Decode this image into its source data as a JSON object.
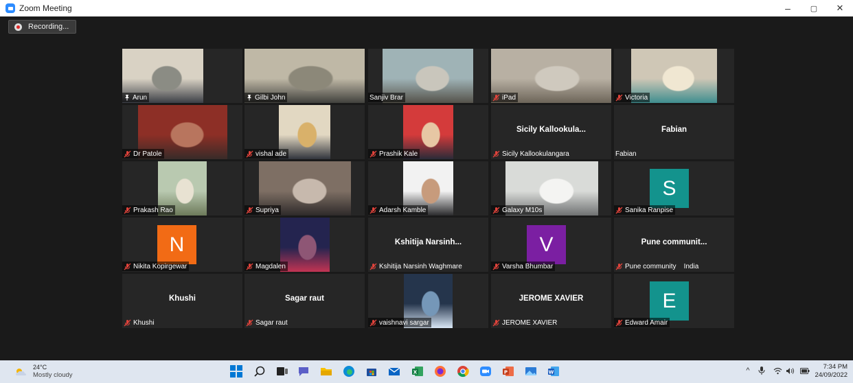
{
  "window": {
    "title": "Zoom Meeting",
    "controls": [
      "–",
      "▢",
      "✕"
    ]
  },
  "recording": {
    "label": "Recording..."
  },
  "accent": "#9cd33c",
  "tiles": [
    {
      "name": "Arun",
      "type": "video",
      "pinned": true
    },
    {
      "name": "Gilbi John",
      "type": "video",
      "pinned": true,
      "active": true
    },
    {
      "name": "Sanjiv Brar",
      "type": "video",
      "no_mic": true
    },
    {
      "name": "iPad",
      "type": "video"
    },
    {
      "name": "Victoria",
      "type": "video"
    },
    {
      "name": "Dr Patole",
      "type": "video"
    },
    {
      "name": "vishal ade",
      "type": "video"
    },
    {
      "name": "Prashik Kale",
      "type": "video"
    },
    {
      "name": "Sicily Kallookulangara",
      "type": "name",
      "display": "Sicily  Kallookula..."
    },
    {
      "name": "Fabian",
      "type": "name",
      "display": "Fabian",
      "no_mic": true
    },
    {
      "name": "Prakash Rao",
      "type": "video"
    },
    {
      "name": "Supriya",
      "type": "video"
    },
    {
      "name": "Adarsh Kamble",
      "type": "video"
    },
    {
      "name": "Galaxy M10s",
      "type": "video"
    },
    {
      "name": "Sanika Ranpise",
      "type": "avatar",
      "letter": "S",
      "color": "#13938d"
    },
    {
      "name": "Nikita Kopirgewar",
      "type": "avatar",
      "letter": "N",
      "color": "#f26b15"
    },
    {
      "name": "Magdalen",
      "type": "video"
    },
    {
      "name": "Kshitija Narsinh Waghmare",
      "type": "name",
      "display": "Kshitija  Narsinh..."
    },
    {
      "name": "Varsha Bhumbar",
      "type": "avatar",
      "letter": "V",
      "color": "#7b1fa2"
    },
    {
      "name": "Pune community    India",
      "type": "name",
      "display": "Pune  communit..."
    },
    {
      "name": "Khushi",
      "type": "name",
      "display": "Khushi"
    },
    {
      "name": "Sagar raut",
      "type": "name",
      "display": "Sagar raut"
    },
    {
      "name": "vaishnavi sargar",
      "type": "video"
    },
    {
      "name": "JEROME XAVIER",
      "type": "name",
      "display": "JEROME XAVIER"
    },
    {
      "name": "Edward Amair",
      "type": "avatar",
      "letter": "E",
      "color": "#13938d"
    }
  ],
  "taskbar": {
    "weather": {
      "temp": "24°C",
      "condition": "Mostly cloudy"
    },
    "apps": [
      "start",
      "search",
      "task-view",
      "teams-chat",
      "file-explorer",
      "edge",
      "store",
      "mail",
      "excel",
      "firefox",
      "chrome",
      "zoom",
      "powerpoint",
      "photos",
      "word"
    ],
    "clock": {
      "time": "7:34 PM",
      "date": "24/09/2022"
    }
  }
}
